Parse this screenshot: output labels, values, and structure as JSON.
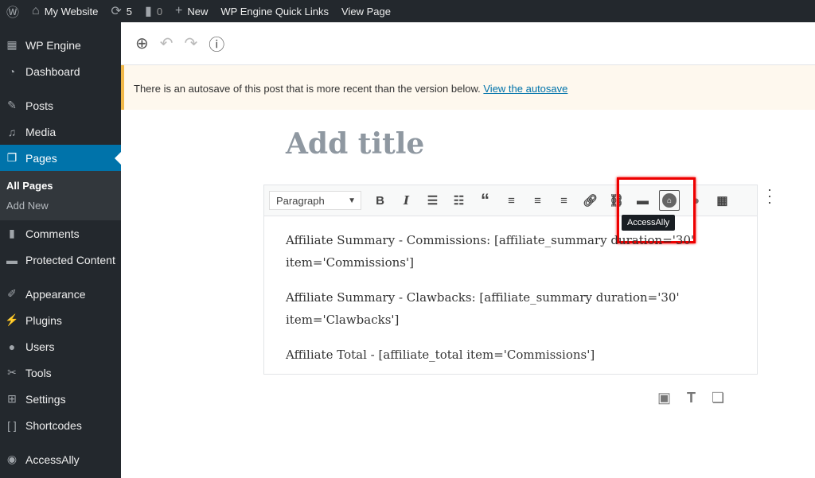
{
  "adminbar": {
    "site": "My Website",
    "updates": "5",
    "comments": "0",
    "new": "New",
    "quicklinks": "WP Engine Quick Links",
    "view": "View Page"
  },
  "sidebar": {
    "items": [
      {
        "label": "WP Engine",
        "icon": "grid-icon"
      },
      {
        "label": "Dashboard",
        "icon": "gauge-icon"
      },
      {
        "label": "Posts",
        "icon": "pin-icon"
      },
      {
        "label": "Media",
        "icon": "media-icon"
      },
      {
        "label": "Pages",
        "icon": "page-icon"
      },
      {
        "label": "Comments",
        "icon": "comment-icon"
      },
      {
        "label": "Protected Content",
        "icon": "folder-icon"
      },
      {
        "label": "Appearance",
        "icon": "brush-icon"
      },
      {
        "label": "Plugins",
        "icon": "plug-icon"
      },
      {
        "label": "Users",
        "icon": "user-icon"
      },
      {
        "label": "Tools",
        "icon": "wrench-icon"
      },
      {
        "label": "Settings",
        "icon": "settings-icon"
      },
      {
        "label": "Shortcodes",
        "icon": "brackets-icon"
      },
      {
        "label": "AccessAlly",
        "icon": "accessally-icon"
      }
    ],
    "submenu": [
      "All Pages",
      "Add New"
    ]
  },
  "notice": {
    "text": "There is an autosave of this post that is more recent than the version below.",
    "link": "View the autosave"
  },
  "editor": {
    "title_placeholder": "Add title",
    "format": "Paragraph",
    "tooltip": "AccessAlly",
    "paragraphs": [
      "Affiliate Summary - Commissions: [affiliate_summary duration='30' item='Commissions']",
      "Affiliate Summary - Clawbacks: [affiliate_summary duration='30' item='Clawbacks']",
      "Affiliate Total - [affiliate_total item='Commissions']"
    ]
  },
  "colors": {
    "accent": "#0073aa",
    "adminbar": "#23282d",
    "highlight": "#e00000"
  }
}
